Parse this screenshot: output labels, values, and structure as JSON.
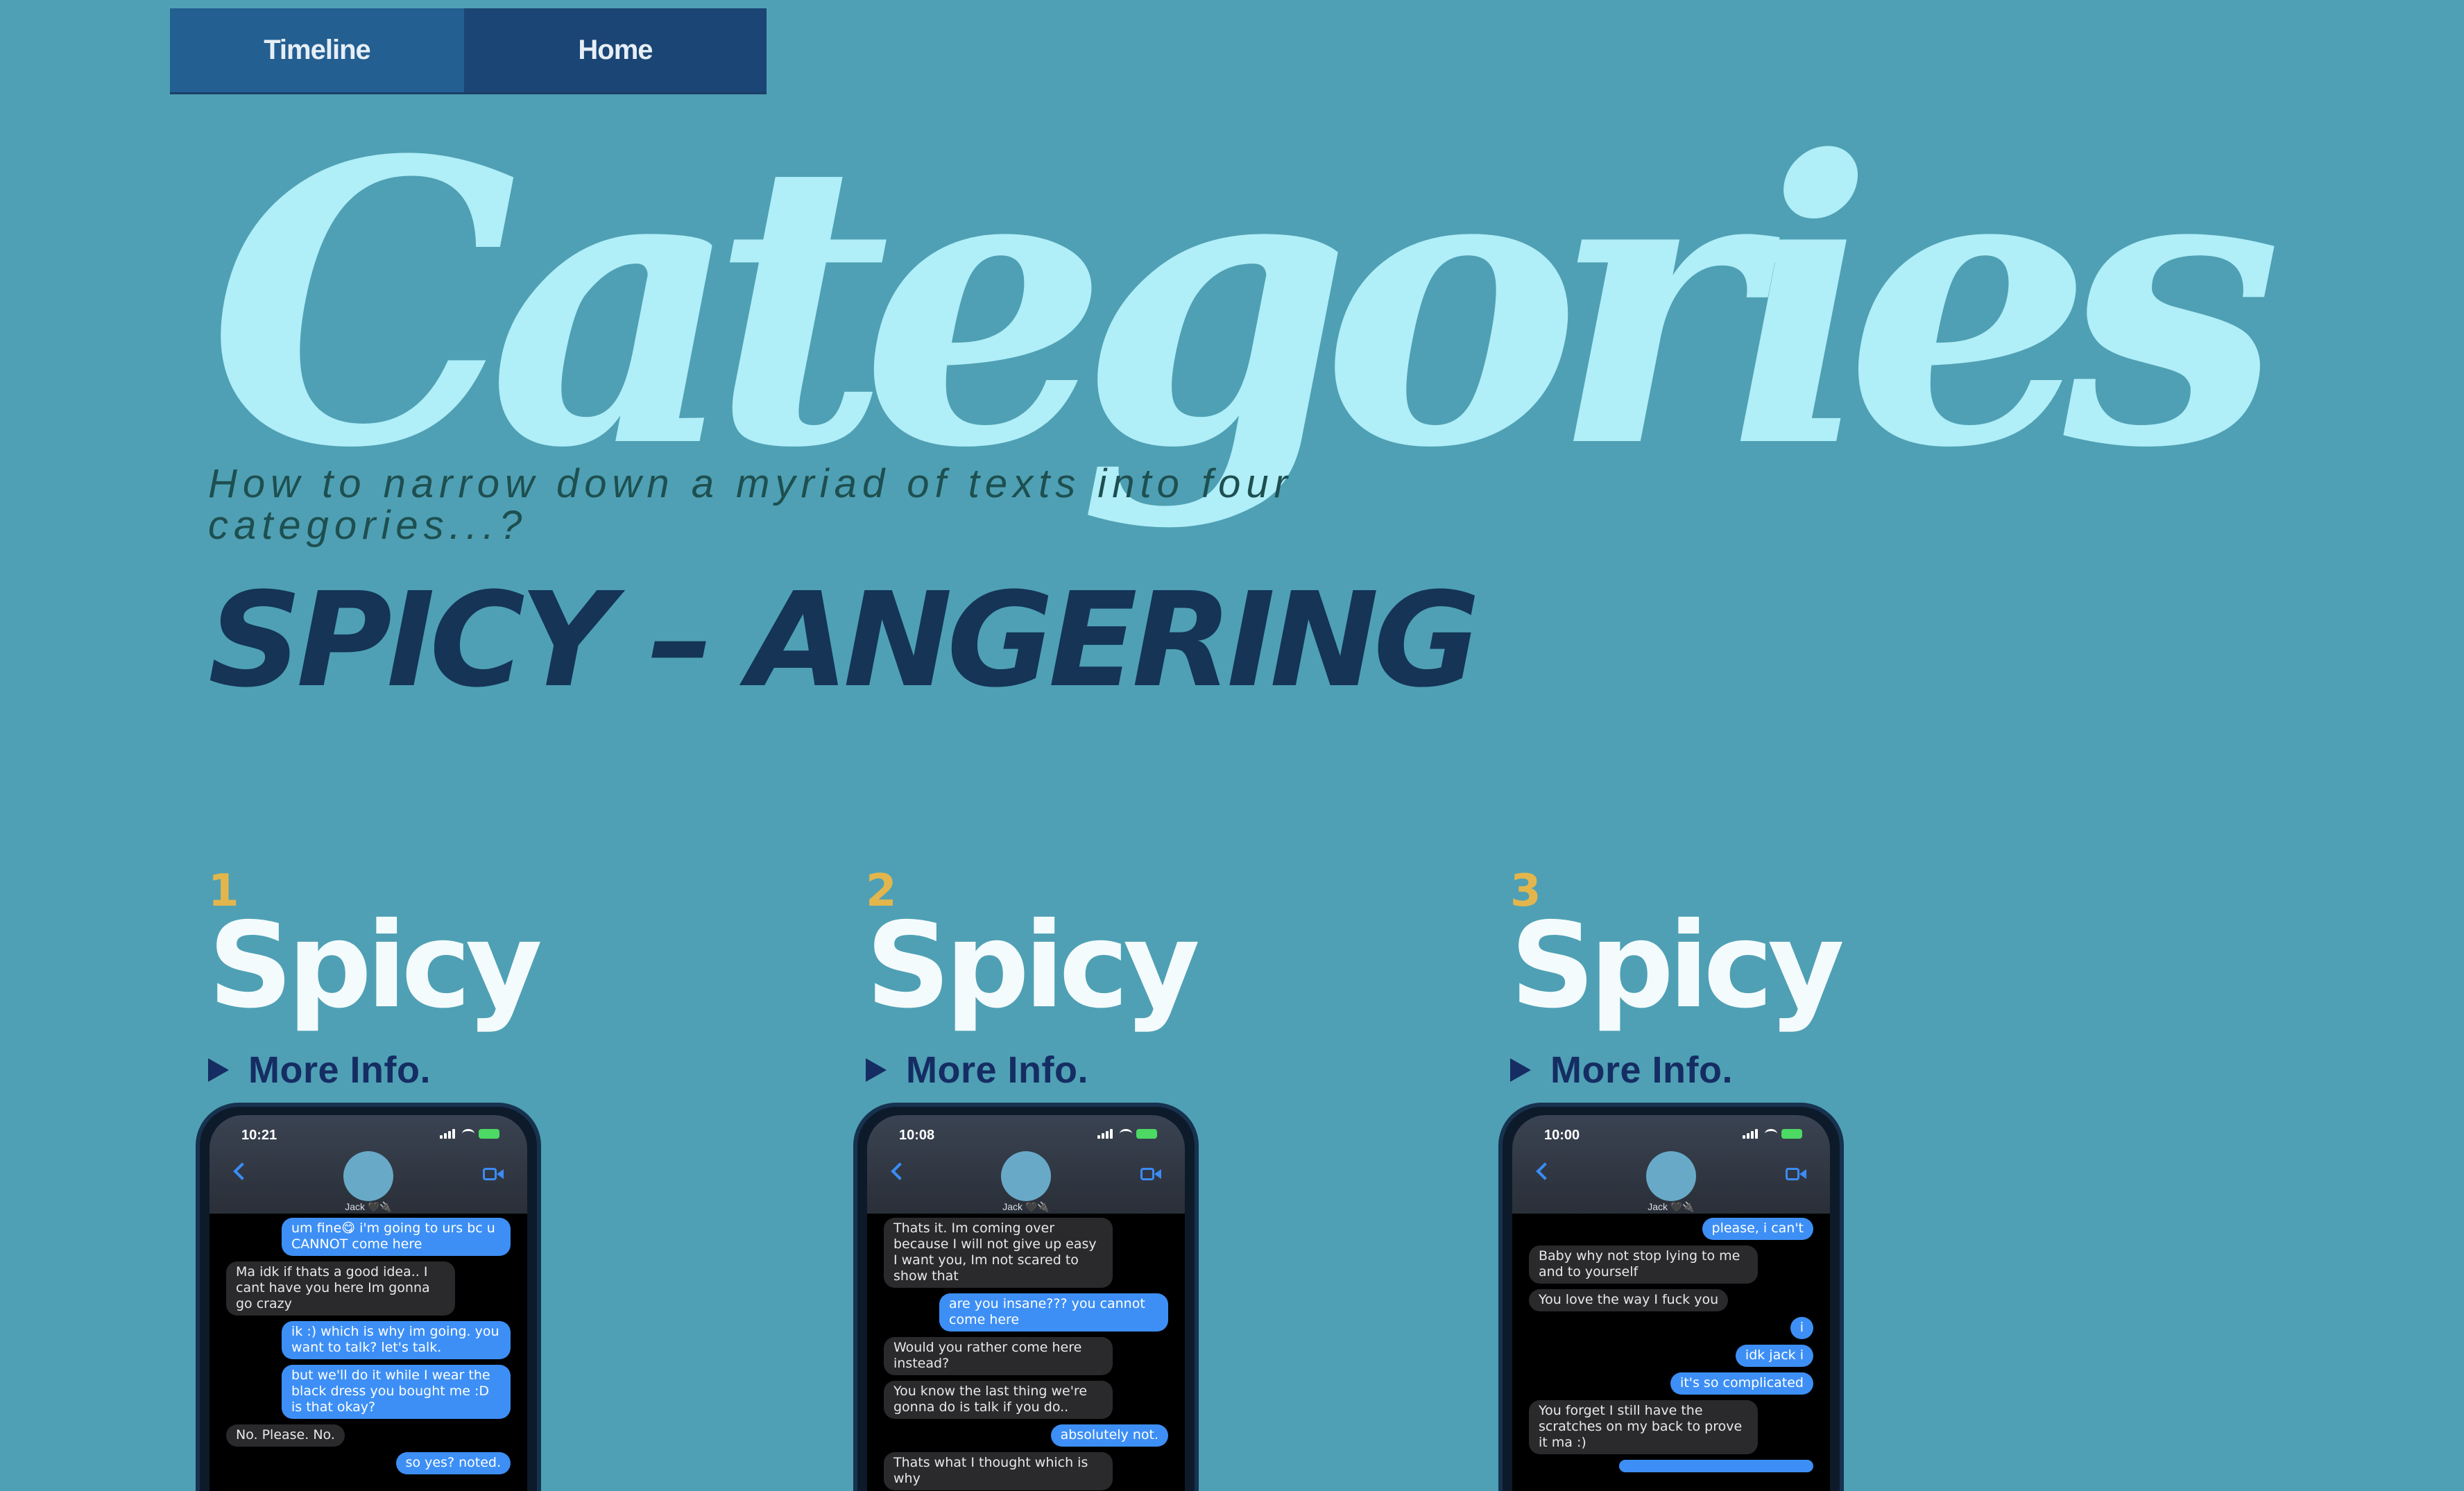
{
  "nav": {
    "timeline": "Timeline",
    "home": "Home"
  },
  "page": {
    "title": "Categories",
    "subtitle": "How to narrow down a myriad of texts into four categories...?",
    "section_title": "SPICY – ANGERING"
  },
  "colors": {
    "background": "#4fa0b4",
    "title": "#b0eef8",
    "section_title": "#153456",
    "number": "#e3b64d",
    "nav_timeline": "#235f91",
    "nav_home": "#1a4574",
    "bubble_out": "#3d8ff5",
    "bubble_in": "#2a2a2c"
  },
  "cards": [
    {
      "number": "1",
      "title": "Spicy",
      "more_info": "More Info.",
      "phone": {
        "time": "10:21",
        "contact": "Jack 🖤🔌",
        "battery": "",
        "messages": [
          {
            "dir": "out",
            "text": "um fine😋 i'm going to urs bc u CANNOT come here"
          },
          {
            "dir": "in",
            "text": "Ma idk if thats a good idea.. I cant have you here Im gonna go crazy"
          },
          {
            "dir": "out",
            "text": "ik :) which is why im going. you want to talk? let's talk."
          },
          {
            "dir": "out",
            "text": "but we'll do it while I wear the black dress you bought me :D is that okay?"
          },
          {
            "dir": "in",
            "text": "No. Please. No."
          },
          {
            "dir": "out",
            "text": "so yes? noted."
          }
        ]
      }
    },
    {
      "number": "2",
      "title": "Spicy",
      "more_info": "More Info.",
      "phone": {
        "time": "10:08",
        "contact": "Jack 🖤🔌",
        "battery": "",
        "messages": [
          {
            "dir": "in",
            "text": "Thats it. Im coming over because I will not give up easy I want you, Im not scared to show that"
          },
          {
            "dir": "out",
            "text": "are you insane??? you cannot come here"
          },
          {
            "dir": "in",
            "text": "Would you rather come here instead?"
          },
          {
            "dir": "in",
            "text": "You know the last thing we're gonna do is talk if you do.."
          },
          {
            "dir": "out",
            "text": "absolutely not."
          },
          {
            "dir": "in",
            "text": "Thats what I thought which is why"
          }
        ]
      }
    },
    {
      "number": "3",
      "title": "Spicy",
      "more_info": "More Info.",
      "phone": {
        "time": "10:00",
        "contact": "Jack 🖤🔌",
        "battery": "",
        "messages": [
          {
            "dir": "out",
            "text": "please, i can't"
          },
          {
            "dir": "in",
            "text": "Baby why not stop lying to me and to yourself"
          },
          {
            "dir": "in",
            "text": "You love the way I fuck you"
          },
          {
            "dir": "out",
            "text": "i"
          },
          {
            "dir": "out",
            "text": "idk jack i"
          },
          {
            "dir": "out",
            "text": "it's so complicated"
          },
          {
            "dir": "in",
            "text": "You forget I still have the scratches on my back to prove it ma :)"
          },
          {
            "dir": "out",
            "text": ""
          }
        ]
      }
    }
  ]
}
